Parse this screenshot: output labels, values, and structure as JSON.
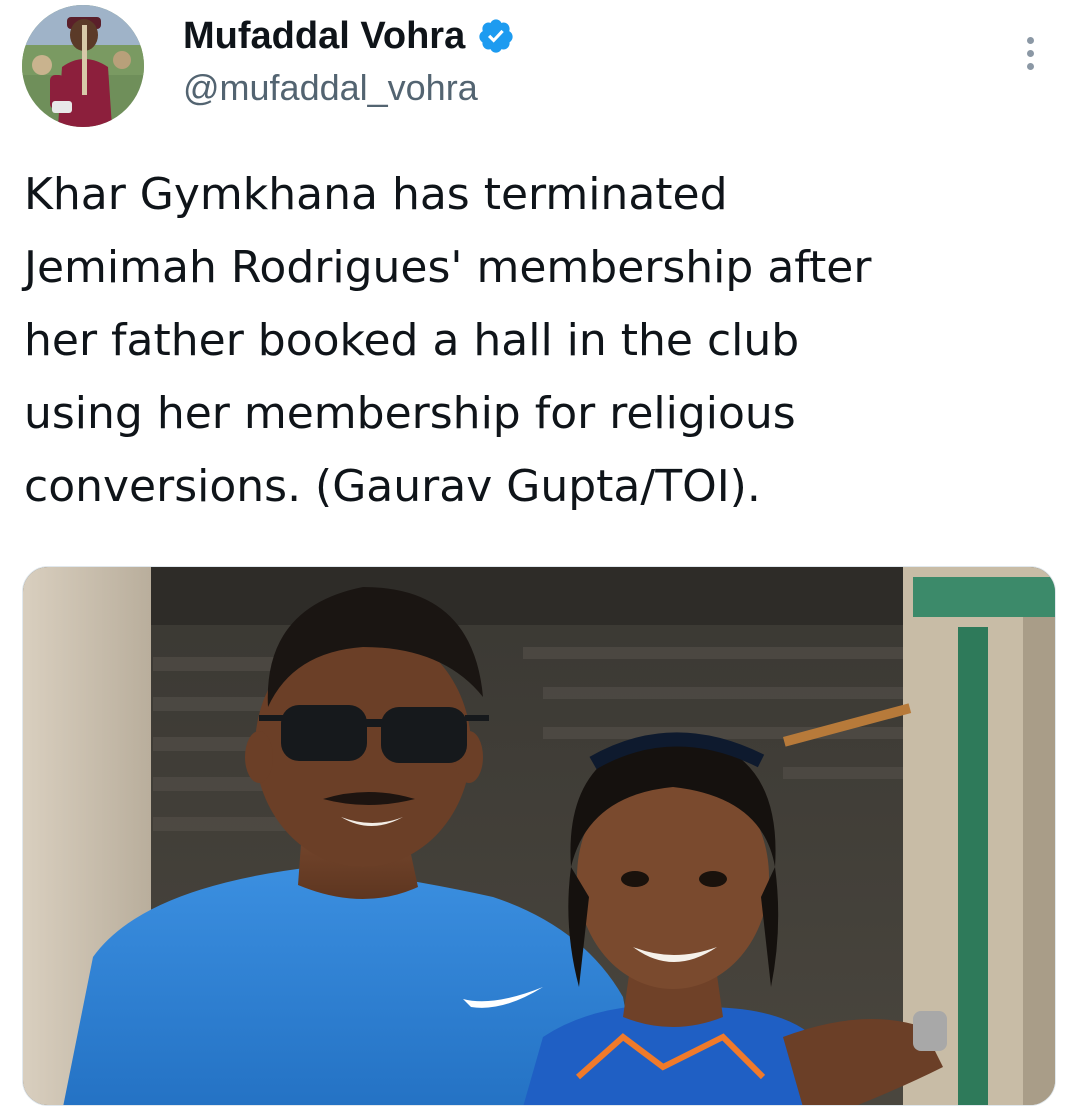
{
  "author": {
    "display_name": "Mufaddal Vohra",
    "handle": "@mufaddal_vohra",
    "verified": true,
    "avatar_icon": "cricketer-avatar",
    "verified_icon": "verified-badge-icon",
    "verified_color": "#1d9bf0"
  },
  "actions": {
    "more_icon": "more-vertical-icon"
  },
  "tweet": {
    "lines": [
      "Khar Gymkhana has terminated",
      "Jemimah Rodrigues' membership after",
      "her father booked a hall in the club",
      "using her membership for religious",
      "conversions. (Gaurav Gupta/TOI)."
    ]
  },
  "media": {
    "kind": "photo",
    "shirt_color": "#2c82d6",
    "jersey_color": "#1f5fc4"
  }
}
